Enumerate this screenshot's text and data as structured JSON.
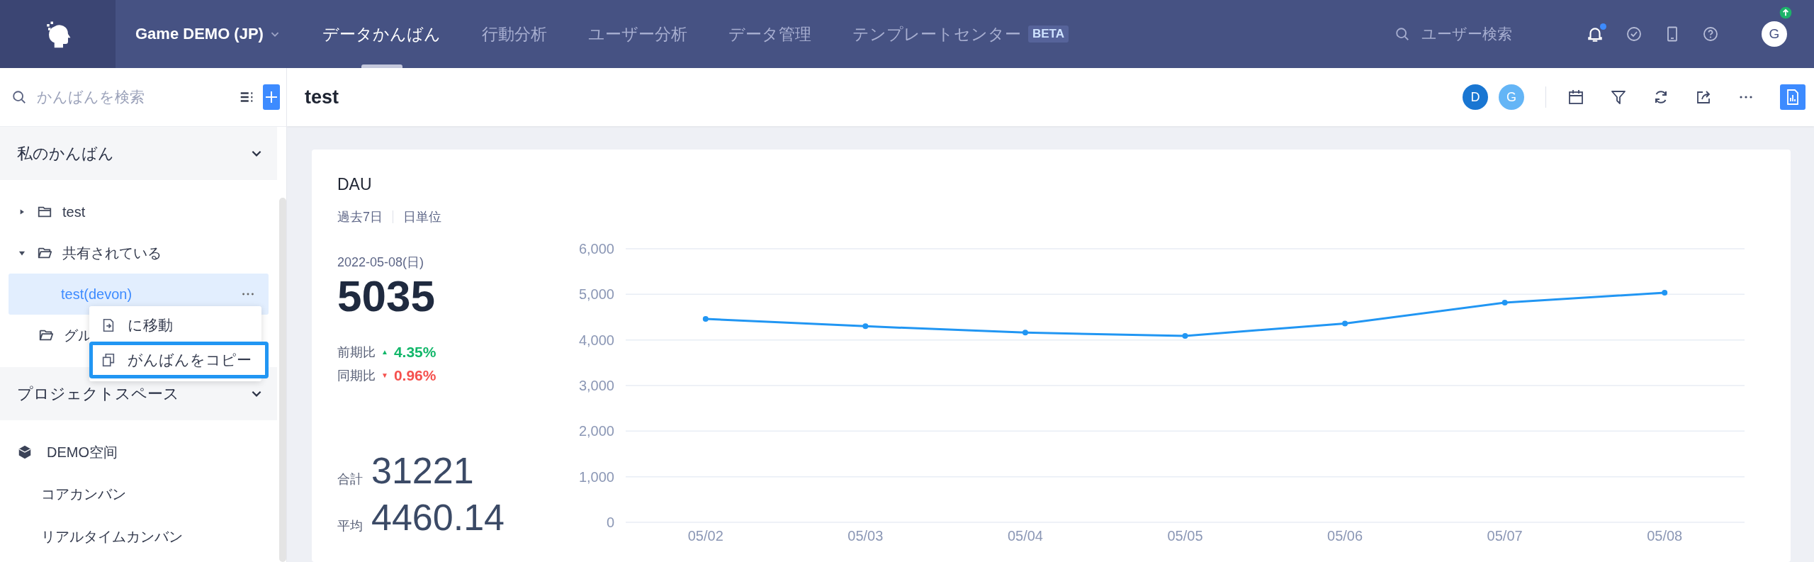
{
  "topbar": {
    "project": "Game DEMO (JP)",
    "nav": [
      {
        "label": "データかんばん",
        "selected": true
      },
      {
        "label": "行動分析",
        "selected": false
      },
      {
        "label": "ユーザー分析",
        "selected": false
      },
      {
        "label": "データ管理",
        "selected": false
      },
      {
        "label": "テンプレートセンター",
        "selected": false,
        "badge": "BETA"
      }
    ],
    "search": {
      "placeholder": "ユーザー検索"
    },
    "has_unread": true,
    "avatar": "G"
  },
  "sidebar": {
    "search": {
      "placeholder": "かんばんを検索"
    },
    "sections": [
      {
        "title": "私のかんばん",
        "expanded": true,
        "items": [
          {
            "kind": "folder",
            "label": "test",
            "expanded": false
          },
          {
            "kind": "folder",
            "label": "共有されている",
            "expanded": true,
            "children": [
              {
                "kind": "board",
                "label": "test(devon)",
                "selected": true
              }
            ]
          },
          {
            "kind": "folder",
            "label": "グル"
          }
        ]
      },
      {
        "title": "プロジェクトスペース",
        "expanded": true,
        "items": [
          {
            "kind": "space",
            "label": "DEMO空间",
            "children": [
              {
                "kind": "board",
                "label": "コアカンバン",
                "selected": false
              },
              {
                "kind": "board",
                "label": "リアルタイムカンバン",
                "selected": false
              }
            ]
          }
        ]
      }
    ],
    "context_menu": [
      {
        "kind": "move",
        "label": "に移動",
        "selected": false
      },
      {
        "kind": "copy",
        "label": "がんばんをコピー",
        "selected": true
      }
    ]
  },
  "header": {
    "title": "test",
    "members": [
      {
        "initial": "D",
        "color": "#1976d2"
      },
      {
        "initial": "G",
        "color": "#64b5f6"
      }
    ]
  },
  "card": {
    "title": "DAU",
    "tags": [
      "過去7日",
      "日単位"
    ],
    "date": "2022-05-08(日)",
    "value": "5035",
    "comparisons": [
      {
        "label": "前期比",
        "arrow": "▲",
        "value": "4.35%",
        "color": "#12b76a"
      },
      {
        "label": "同期比",
        "arrow": "▼",
        "value": "0.96%",
        "color": "#f5514e"
      }
    ],
    "totals": [
      {
        "label": "合計",
        "value": "31221"
      },
      {
        "label": "平均",
        "value": "4460.14"
      }
    ],
    "chart_data": {
      "type": "line",
      "categories": [
        "05/02",
        "05/03",
        "05/04",
        "05/05",
        "05/06",
        "05/07",
        "05/08"
      ],
      "series": [
        {
          "color": "#2196f3",
          "marker": true,
          "values": [
            4460,
            4300,
            4160,
            4090,
            4360,
            4820,
            5035
          ]
        }
      ],
      "grid": true,
      "ylim": [
        0,
        6000
      ],
      "yticks": [
        {
          "value": 0,
          "label": "0"
        },
        {
          "value": 1000,
          "label": "1,000"
        },
        {
          "value": 2000,
          "label": "2,000"
        },
        {
          "value": 3000,
          "label": "3,000"
        },
        {
          "value": 4000,
          "label": "4,000"
        },
        {
          "value": 5000,
          "label": "5,000"
        },
        {
          "value": 6000,
          "label": "6,000"
        }
      ]
    }
  }
}
